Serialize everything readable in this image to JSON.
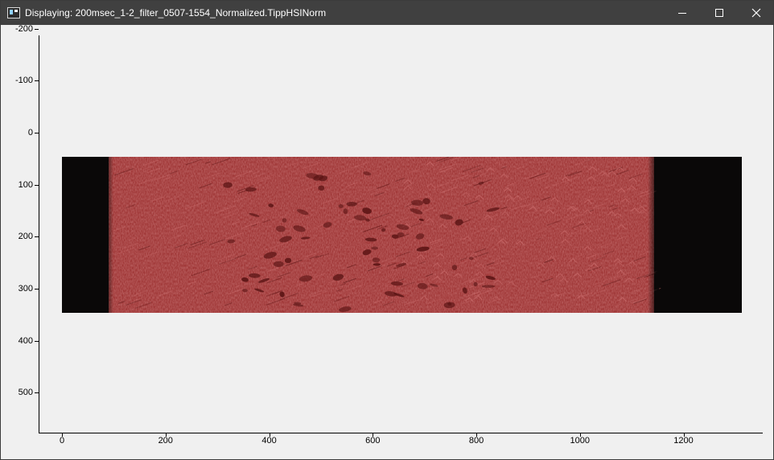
{
  "window": {
    "title": "Displaying: 200msec_1-2_filter_0507-1554_Normalized.TippHSINorm",
    "icon": "image-viewer-icon",
    "controls": [
      "minimize-icon",
      "maximize-icon",
      "close-icon"
    ]
  },
  "plot": {
    "image_extent": {
      "x": [
        0,
        1310
      ],
      "y": [
        0,
        300
      ]
    },
    "x_axis": {
      "range": [
        -45,
        1360
      ],
      "ticks": [
        0,
        200,
        400,
        600,
        800,
        1000,
        1200
      ],
      "labels": [
        "0",
        "200",
        "400",
        "600",
        "800",
        "1000",
        "1200"
      ]
    },
    "y_axis": {
      "range": [
        -235,
        535
      ],
      "inverted": true,
      "ticks": [
        -200,
        -100,
        0,
        100,
        200,
        300,
        400,
        500
      ],
      "labels": [
        "-200",
        "-100",
        "0",
        "100",
        "200",
        "300",
        "400",
        "500"
      ]
    },
    "image_colors": {
      "dark_edge": "#0a0808",
      "red_tissue": "#9e3434",
      "highlight": "#c86a6a",
      "shadow": "#5a1414"
    }
  }
}
